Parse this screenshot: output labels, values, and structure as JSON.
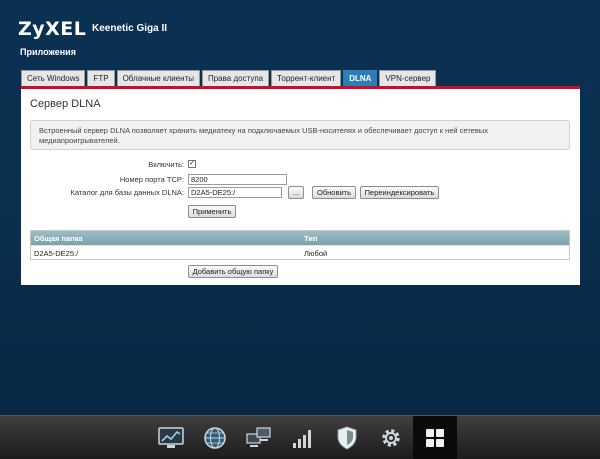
{
  "brand": {
    "logo": "ZyXEL",
    "model": "Keenetic Giga II"
  },
  "section": "Приложения",
  "tabs": [
    {
      "label": "Сеть Windows",
      "active": false
    },
    {
      "label": "FTP",
      "active": false
    },
    {
      "label": "Облачные клиенты",
      "active": false
    },
    {
      "label": "Права доступа",
      "active": false
    },
    {
      "label": "Торрент-клиент",
      "active": false
    },
    {
      "label": "DLNA",
      "active": true
    },
    {
      "label": "VPN-сервер",
      "active": false
    }
  ],
  "panel": {
    "title": "Сервер DLNA",
    "info_line1": "Встроенный сервер DLNA позволяет хранить медиатеку на подключаемых USB-носителях и обеспечивает доступ к ней сетевых",
    "info_line2": "медиапроигрывателей."
  },
  "form": {
    "enable_label": "Включить:",
    "enabled": true,
    "enabled_mark": "✓",
    "port_label": "Номер порта TCP:",
    "port_value": "8200",
    "catalog_label": "Каталог для базы данных DLNA:",
    "catalog_value": "D2A5-DE25:/",
    "browse_label": "...",
    "refresh_label": "Обновить",
    "reindex_label": "Переиндексировать",
    "apply_label": "Применить"
  },
  "table": {
    "headers": [
      "Общая папка",
      "Тип"
    ],
    "rows": [
      {
        "folder": "D2A5-DE25:/",
        "type": "Любой"
      }
    ]
  },
  "add_folder_label": "Добавить общую папку",
  "taskbar": {
    "icons": [
      {
        "name": "monitor-graph-icon",
        "active": false
      },
      {
        "name": "globe-icon",
        "active": false
      },
      {
        "name": "network-computers-icon",
        "active": false
      },
      {
        "name": "signal-bars-icon",
        "active": false
      },
      {
        "name": "shield-icon",
        "active": false
      },
      {
        "name": "gear-icon",
        "active": false
      },
      {
        "name": "apps-grid-icon",
        "active": true
      }
    ]
  },
  "colors": {
    "accent": "#2d7db8",
    "brand_red": "#c8102e",
    "background": "#0a2f4f"
  }
}
